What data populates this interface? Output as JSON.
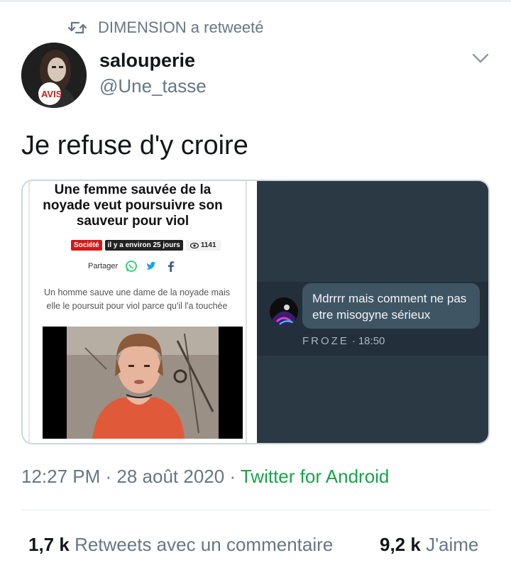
{
  "retweet": {
    "text": "DIMENSION a retweeté",
    "icon": "retweet-icon"
  },
  "author": {
    "display_name": "salouperie",
    "handle": "@Une_tasse",
    "avatar_badge": "AVIS"
  },
  "tweet": {
    "text": "Je refuse d'y croire"
  },
  "article": {
    "title": "Une femme sauvée de la noyade veut poursuivre son sauveur pour viol",
    "category": "Société",
    "age": "il y a environ 25 jours",
    "views": "1141",
    "share_label": "Partager",
    "summary": "Un homme sauve une dame de la noyade mais elle le poursuit pour viol parce qu'il l'a touchée"
  },
  "chat": {
    "message": "Mdrrrr mais comment ne pas etre misogyne sérieux",
    "sender": "FROZE",
    "separator": "·",
    "time": "18:50"
  },
  "meta": {
    "time": "12:27 PM",
    "sep1": " · ",
    "date": "28 août 2020",
    "sep2": " · ",
    "source": "Twitter for Android",
    "source_color": "#17a34a"
  },
  "stats": {
    "retweets_count": "1,7 k",
    "retweets_label": "Retweets avec un commentaire",
    "likes_count": "9,2 k",
    "likes_label": "J'aime"
  },
  "colors": {
    "secondary_text": "#657786",
    "primary_text": "#14171a",
    "chat_bg": "#2b3945",
    "bubble": "#3f5564"
  }
}
